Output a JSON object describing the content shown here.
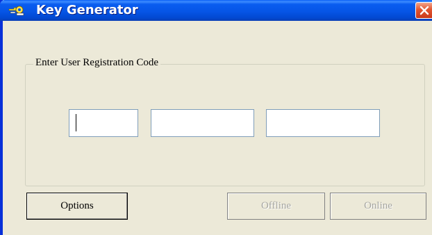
{
  "window": {
    "title": "Key Generator",
    "icon": "keygen-app-icon",
    "close_icon": "close-icon"
  },
  "registration": {
    "group_label": "Enter User Registration Code",
    "fields": [
      {
        "value": ""
      },
      {
        "value": ""
      },
      {
        "value": ""
      }
    ]
  },
  "buttons": {
    "options": {
      "label": "Options",
      "enabled": true
    },
    "offline": {
      "label": "Offline",
      "enabled": false
    },
    "online": {
      "label": "Online",
      "enabled": false
    }
  },
  "colors": {
    "titlebar": "#0655e6",
    "close_button": "#e2542f",
    "dialog_background": "#ece9d8",
    "disabled_text": "#a6a6a0"
  }
}
